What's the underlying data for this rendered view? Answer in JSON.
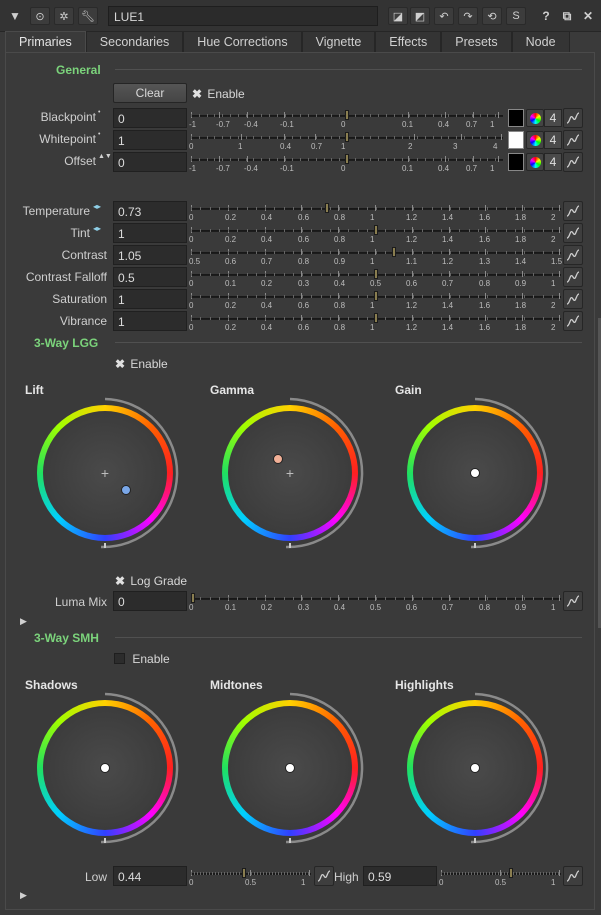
{
  "node": {
    "name": "LUE1"
  },
  "toolbar": {
    "help_label": "?",
    "s_label": "S"
  },
  "tabs": [
    "Primaries",
    "Secondaries",
    "Hue Corrections",
    "Vignette",
    "Effects",
    "Presets",
    "Node"
  ],
  "general": {
    "title": "General",
    "clear_label": "Clear",
    "enable_label": "Enable",
    "enable_checked": true,
    "rows": [
      {
        "label": "Blackpoint",
        "value": "0",
        "marker": "•",
        "ticks": [
          "-1",
          "-0.7",
          "-0.4",
          "-0.1",
          "0",
          "0.1",
          "0.4",
          "0.7",
          "1"
        ],
        "ticks_pos": [
          0,
          0.09,
          0.18,
          0.3,
          0.5,
          0.7,
          0.82,
          0.91,
          0.99
        ],
        "knob": 0.5,
        "swatch": "#000000",
        "num": "4"
      },
      {
        "label": "Whitepoint",
        "value": "1",
        "marker": "•",
        "ticks": [
          "0",
          "1",
          "0.4",
          "0.7",
          "1",
          "2",
          "3",
          "4"
        ],
        "ticks_pos": [
          0,
          0.16,
          0.3,
          0.4,
          0.5,
          0.72,
          0.87,
          1.0
        ],
        "knob": 0.5,
        "swatch": "#ffffff",
        "num": "4"
      },
      {
        "label": "Offset",
        "value": "0",
        "marker": "▲▼",
        "ticks": [
          "-1",
          "-0.7",
          "-0.4",
          "-0.1",
          "0",
          "0.1",
          "0.4",
          "0.7",
          "1"
        ],
        "ticks_pos": [
          0,
          0.09,
          0.18,
          0.3,
          0.5,
          0.7,
          0.82,
          0.91,
          0.99
        ],
        "knob": 0.5,
        "swatch": "#000000",
        "num": "4"
      }
    ]
  },
  "adjust": {
    "rows": [
      {
        "label": "Temperature",
        "value": "0.73",
        "marker": "◂▸",
        "ticks": [
          "0",
          "0.2",
          "0.4",
          "0.6",
          "0.8",
          "1",
          "1.2",
          "1.4",
          "1.6",
          "1.8",
          "2"
        ],
        "knob": 0.365
      },
      {
        "label": "Tint",
        "value": "1",
        "marker": "◂▸",
        "ticks": [
          "0",
          "0.2",
          "0.4",
          "0.6",
          "0.8",
          "1",
          "1.2",
          "1.4",
          "1.6",
          "1.8",
          "2"
        ],
        "knob": 0.5
      },
      {
        "label": "Contrast",
        "value": "1.05",
        "marker": "",
        "ticks": [
          "0.5",
          "0.6",
          "0.7",
          "0.8",
          "0.9",
          "1",
          "1.1",
          "1.2",
          "1.3",
          "1.4",
          "1.5"
        ],
        "knob": 0.55
      },
      {
        "label": "Contrast Falloff",
        "value": "0.5",
        "marker": "",
        "ticks": [
          "0",
          "0.1",
          "0.2",
          "0.3",
          "0.4",
          "0.5",
          "0.6",
          "0.7",
          "0.8",
          "0.9",
          "1"
        ],
        "knob": 0.5
      },
      {
        "label": "Saturation",
        "value": "1",
        "marker": "",
        "ticks": [
          "0",
          "0.2",
          "0.4",
          "0.6",
          "0.8",
          "1",
          "1.2",
          "1.4",
          "1.6",
          "1.8",
          "2"
        ],
        "knob": 0.5
      },
      {
        "label": "Vibrance",
        "value": "1",
        "marker": "",
        "ticks": [
          "0",
          "0.2",
          "0.4",
          "0.6",
          "0.8",
          "1",
          "1.2",
          "1.4",
          "1.6",
          "1.8",
          "2"
        ],
        "knob": 0.5
      }
    ]
  },
  "lgg": {
    "title": "3-Way LGG",
    "enable_label": "Enable",
    "enable_checked": true,
    "wheels": [
      {
        "title": "Lift",
        "center_mark": true,
        "dot": {
          "dx": 0.36,
          "dy": 0.29,
          "color": "#7aa7e8"
        }
      },
      {
        "title": "Gamma",
        "center_mark": true,
        "dot": {
          "dx": -0.2,
          "dy": -0.24,
          "color": "#f2b097"
        }
      },
      {
        "title": "Gain",
        "center_mark": false,
        "dot": {
          "dx": 0,
          "dy": 0,
          "color": "#ffffff"
        }
      }
    ],
    "log_grade_label": "Log Grade",
    "log_grade_checked": true,
    "luma_mix": {
      "label": "Luma Mix",
      "value": "0",
      "ticks": [
        "0",
        "0.1",
        "0.2",
        "0.3",
        "0.4",
        "0.5",
        "0.6",
        "0.7",
        "0.8",
        "0.9",
        "1"
      ],
      "knob": 0
    }
  },
  "smh": {
    "title": "3-Way SMH",
    "enable_label": "Enable",
    "enable_checked": false,
    "wheels": [
      {
        "title": "Shadows",
        "center_mark": false,
        "dot": {
          "dx": 0,
          "dy": 0,
          "color": "#ffffff"
        }
      },
      {
        "title": "Midtones",
        "center_mark": false,
        "dot": {
          "dx": 0,
          "dy": 0,
          "color": "#ffffff"
        }
      },
      {
        "title": "Highlights",
        "center_mark": false,
        "dot": {
          "dx": 0,
          "dy": 0,
          "color": "#ffffff"
        }
      }
    ],
    "low": {
      "label": "Low",
      "value": "0.44",
      "ticks": [
        "0",
        "0.5",
        "1"
      ],
      "knob": 0.44
    },
    "high": {
      "label": "High",
      "value": "0.59",
      "ticks": [
        "0",
        "0.5",
        "1"
      ],
      "knob": 0.59
    }
  }
}
